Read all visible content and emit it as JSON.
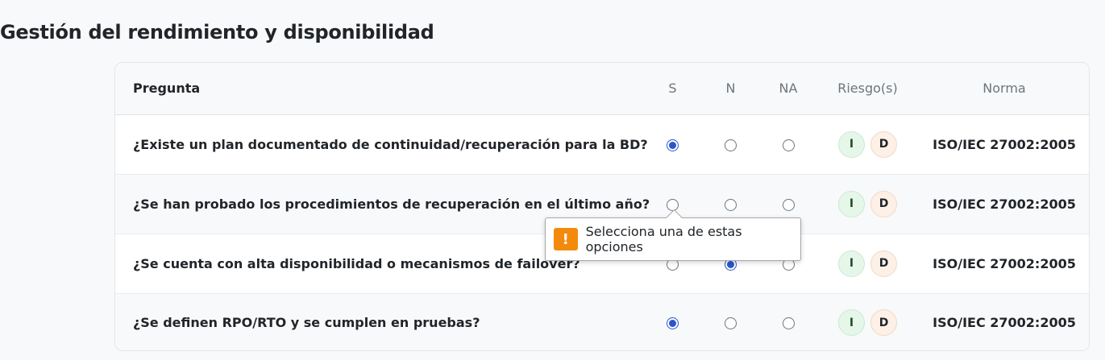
{
  "section": {
    "title": "Gestión del rendimiento y disponibilidad"
  },
  "table": {
    "headers": {
      "question": "Pregunta",
      "yes": "S",
      "no": "N",
      "na": "NA",
      "risks": "Riesgo(s)",
      "standard": "Norma"
    },
    "rows": [
      {
        "question": "¿Existe un plan documentado de continuidad/recuperación para la BD?",
        "selected": "S",
        "risk_i": "I",
        "risk_d": "D",
        "standard": "ISO/IEC 27002:2005"
      },
      {
        "question": "¿Se han probado los procedimientos de recuperación en el último año?",
        "selected": "",
        "risk_i": "I",
        "risk_d": "D",
        "standard": "ISO/IEC 27002:2005"
      },
      {
        "question": "¿Se cuenta con alta disponibilidad o mecanismos de failover?",
        "selected": "N",
        "risk_i": "I",
        "risk_d": "D",
        "standard": "ISO/IEC 27002:2005"
      },
      {
        "question": "¿Se definen RPO/RTO y se cumplen en pruebas?",
        "selected": "S",
        "risk_i": "I",
        "risk_d": "D",
        "standard": "ISO/IEC 27002:2005"
      }
    ]
  },
  "validation_tooltip": {
    "icon": "warning-icon",
    "icon_glyph": "!",
    "message": "Selecciona una de estas opciones"
  },
  "colors": {
    "radio_checked": "#2b55c9",
    "warning": "#f48a0b",
    "badge_i_bg": "#e6f7ea",
    "badge_d_bg": "#fdf0e6"
  }
}
